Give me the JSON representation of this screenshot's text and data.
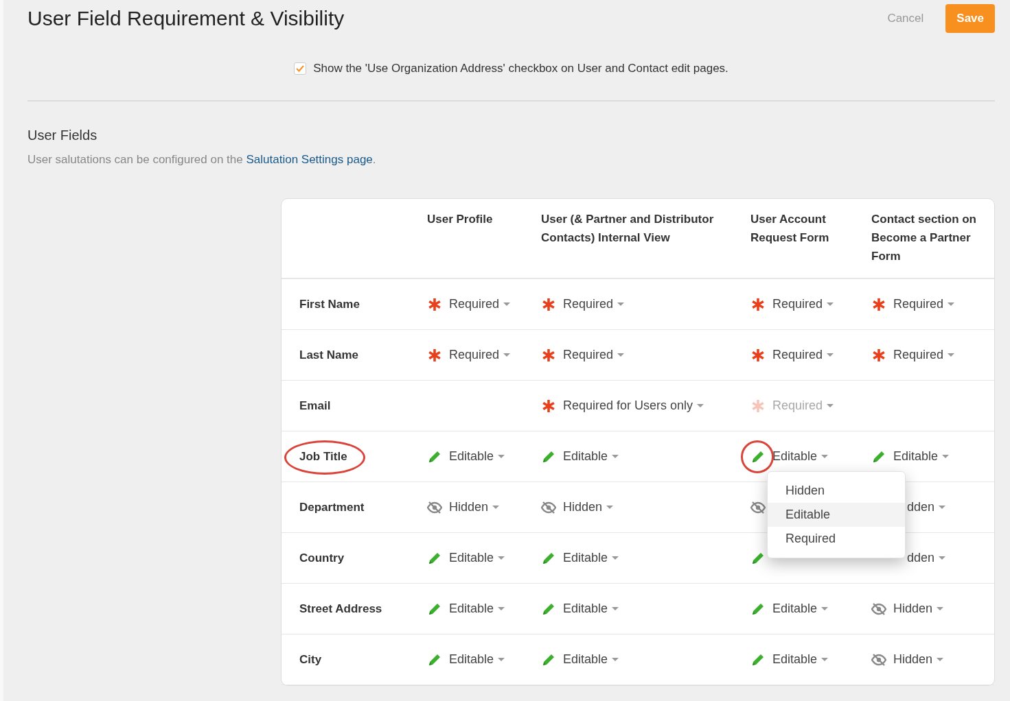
{
  "page": {
    "title": "User Field Requirement & Visibility",
    "cancel": "Cancel",
    "save": "Save"
  },
  "option": {
    "checked": true,
    "label": "Show the 'Use Organization Address' checkbox on User and Contact edit pages."
  },
  "section": {
    "title": "User Fields",
    "note": "User salutations can be configured on the ",
    "link": "Salutation Settings page",
    "after": "."
  },
  "table": {
    "columns": [
      "User Profile",
      "User (& Partner and Distributor Contacts) Internal View",
      "User Account Request Form",
      "Contact section on Become a Partner Form"
    ],
    "rows": [
      {
        "label": "First Name",
        "circled": false,
        "cells": [
          {
            "kind": "required",
            "label": "Required"
          },
          {
            "kind": "required",
            "label": "Required"
          },
          {
            "kind": "required",
            "label": "Required"
          },
          {
            "kind": "required",
            "label": "Required"
          }
        ]
      },
      {
        "label": "Last Name",
        "circled": false,
        "cells": [
          {
            "kind": "required",
            "label": "Required"
          },
          {
            "kind": "required",
            "label": "Required"
          },
          {
            "kind": "required",
            "label": "Required"
          },
          {
            "kind": "required",
            "label": "Required"
          }
        ]
      },
      {
        "label": "Email",
        "circled": false,
        "cells": [
          {
            "kind": "none"
          },
          {
            "kind": "required",
            "label": "Required for Users only"
          },
          {
            "kind": "required",
            "label": "Required",
            "disabled": true
          },
          {
            "kind": "none"
          }
        ]
      },
      {
        "label": "Job Title",
        "circled": true,
        "cells": [
          {
            "kind": "editable",
            "label": "Editable"
          },
          {
            "kind": "editable",
            "label": "Editable"
          },
          {
            "kind": "editable",
            "label": "Editable",
            "circled": true
          },
          {
            "kind": "editable",
            "label": "Editable"
          }
        ]
      },
      {
        "label": "Department",
        "circled": false,
        "cells": [
          {
            "kind": "hidden",
            "label": "Hidden"
          },
          {
            "kind": "hidden",
            "label": "Hidden"
          },
          {
            "kind": "hidden"
          },
          {
            "kind": "covered",
            "label": "dden"
          }
        ]
      },
      {
        "label": "Country",
        "circled": false,
        "cells": [
          {
            "kind": "editable",
            "label": "Editable"
          },
          {
            "kind": "editable",
            "label": "Editable"
          },
          {
            "kind": "editable"
          },
          {
            "kind": "covered",
            "label": "dden"
          }
        ]
      },
      {
        "label": "Street Address",
        "circled": false,
        "cells": [
          {
            "kind": "editable",
            "label": "Editable"
          },
          {
            "kind": "editable",
            "label": "Editable"
          },
          {
            "kind": "editable",
            "label": "Editable"
          },
          {
            "kind": "hidden",
            "label": "Hidden"
          }
        ]
      },
      {
        "label": "City",
        "circled": false,
        "cells": [
          {
            "kind": "editable",
            "label": "Editable"
          },
          {
            "kind": "editable",
            "label": "Editable"
          },
          {
            "kind": "editable",
            "label": "Editable"
          },
          {
            "kind": "hidden",
            "label": "Hidden"
          }
        ]
      }
    ]
  },
  "menu": {
    "options": [
      {
        "label": "Hidden",
        "selected": false
      },
      {
        "label": "Editable",
        "selected": true
      },
      {
        "label": "Required",
        "selected": false
      }
    ]
  }
}
